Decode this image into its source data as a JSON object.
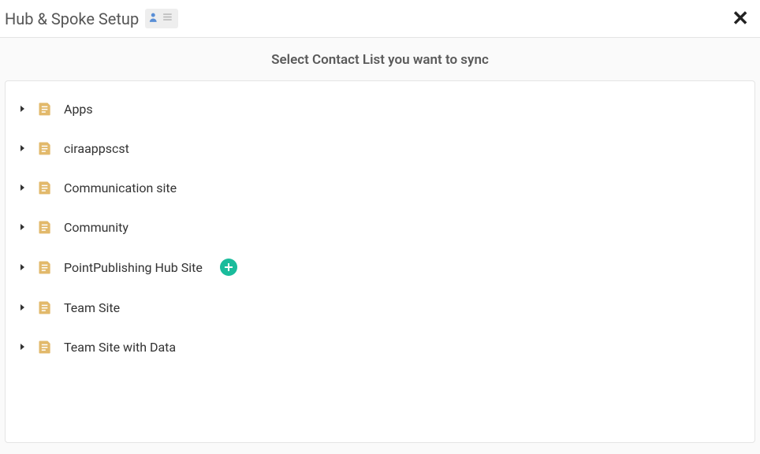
{
  "header": {
    "title": "Hub & Spoke Setup",
    "close_label": "✕"
  },
  "subtitle": "Select Contact List you want to sync",
  "icons": {
    "person": "person-icon",
    "list": "list-icon",
    "expand": "caret-right-icon",
    "folder": "note-folder-icon",
    "add": "plus-icon"
  },
  "colors": {
    "folder": "#e2b96b",
    "folder_inner": "#ffffff",
    "add_bg": "#1abc9c",
    "person": "#5a8fd6"
  },
  "items": [
    {
      "label": "Apps",
      "show_add": false
    },
    {
      "label": "ciraappscst",
      "show_add": false
    },
    {
      "label": "Communication site",
      "show_add": false
    },
    {
      "label": "Community",
      "show_add": false
    },
    {
      "label": "PointPublishing Hub Site",
      "show_add": true
    },
    {
      "label": "Team Site",
      "show_add": false
    },
    {
      "label": "Team Site with Data",
      "show_add": false
    }
  ]
}
